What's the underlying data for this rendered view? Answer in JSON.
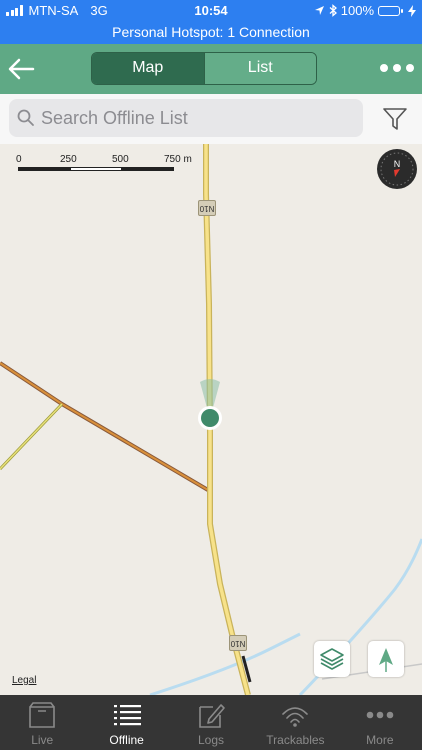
{
  "status_bar": {
    "carrier": "MTN-SA",
    "network": "3G",
    "time": "10:54",
    "battery": "100%",
    "icons": [
      "signal-icon",
      "location-arrow-icon",
      "bluetooth-icon",
      "battery-icon",
      "charging-icon"
    ]
  },
  "hotspot_banner": "Personal Hotspot: 1 Connection",
  "header": {
    "tabs": [
      {
        "label": "Map",
        "selected": true
      },
      {
        "label": "List",
        "selected": false
      }
    ],
    "back_icon": "back-arrow-icon",
    "more_icon": "more-dots-icon"
  },
  "search": {
    "placeholder": "Search Offline List",
    "value": "",
    "filter_icon": "filter-icon"
  },
  "map": {
    "scale_labels": [
      "0",
      "250",
      "500",
      "750 m"
    ],
    "road_labels": [
      "N10",
      "N10"
    ],
    "compass_label": "N",
    "legal_link": "Legal",
    "layers_icon": "layers-icon",
    "locate_icon": "navigation-arrow-icon"
  },
  "tabbar": {
    "items": [
      {
        "label": "Live",
        "icon": "box-icon",
        "active": false
      },
      {
        "label": "Offline",
        "icon": "list-icon",
        "active": true
      },
      {
        "label": "Logs",
        "icon": "pencil-icon",
        "active": false
      },
      {
        "label": "Trackables",
        "icon": "wifi-signal-icon",
        "active": false
      },
      {
        "label": "More",
        "icon": "more-dots-icon",
        "active": false
      }
    ]
  },
  "colors": {
    "status_bar": "#2d7ff0",
    "header": "#5fa985",
    "segment_selected": "#2f6b4f",
    "location_dot": "#3f8a6a",
    "tab_bar": "#353535"
  }
}
